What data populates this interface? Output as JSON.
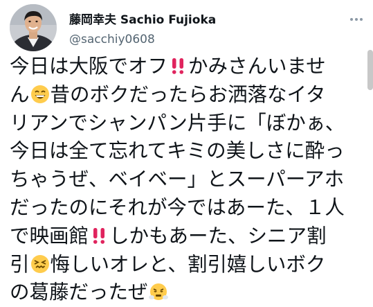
{
  "user": {
    "display_name": "藤岡幸夫 Sachio Fujioka",
    "handle": "@sacchiy0608"
  },
  "colors": {
    "text": "#0f1419",
    "handle": "#536471",
    "emoji_alert": "#e0245e",
    "emoji_face": "#ffcc4d"
  },
  "icons": {
    "double_exclamation": "double-exclamation-icon",
    "grin": "grinning-face-icon",
    "persevere": "persevering-face-icon",
    "steam": "face-with-steam-icon",
    "more": "more-options-icon"
  },
  "tweet": {
    "line1": {
      "a": "今日は大阪でオフ",
      "b": "かみさんいませ"
    },
    "line2": {
      "a": "ん",
      "b": "昔のボクだったらお洒落なイタ"
    },
    "line3": "リアンでシャンパン片手に「ぼかぁ、",
    "line4": "今日は全て忘れてキミの美しさに酔っ",
    "line5": "ちゃうぜ、ベイベー」とスーパーアホ",
    "line6": "だったのにそれが今ではあーた、１人",
    "line7": {
      "a": "で映画館",
      "b": "しかもあーた、シニア割"
    },
    "line8": {
      "a": "引",
      "b": "悔しいオレと、割引嬉しいボク"
    },
    "line9": {
      "a": "の葛藤だったぜ"
    }
  }
}
